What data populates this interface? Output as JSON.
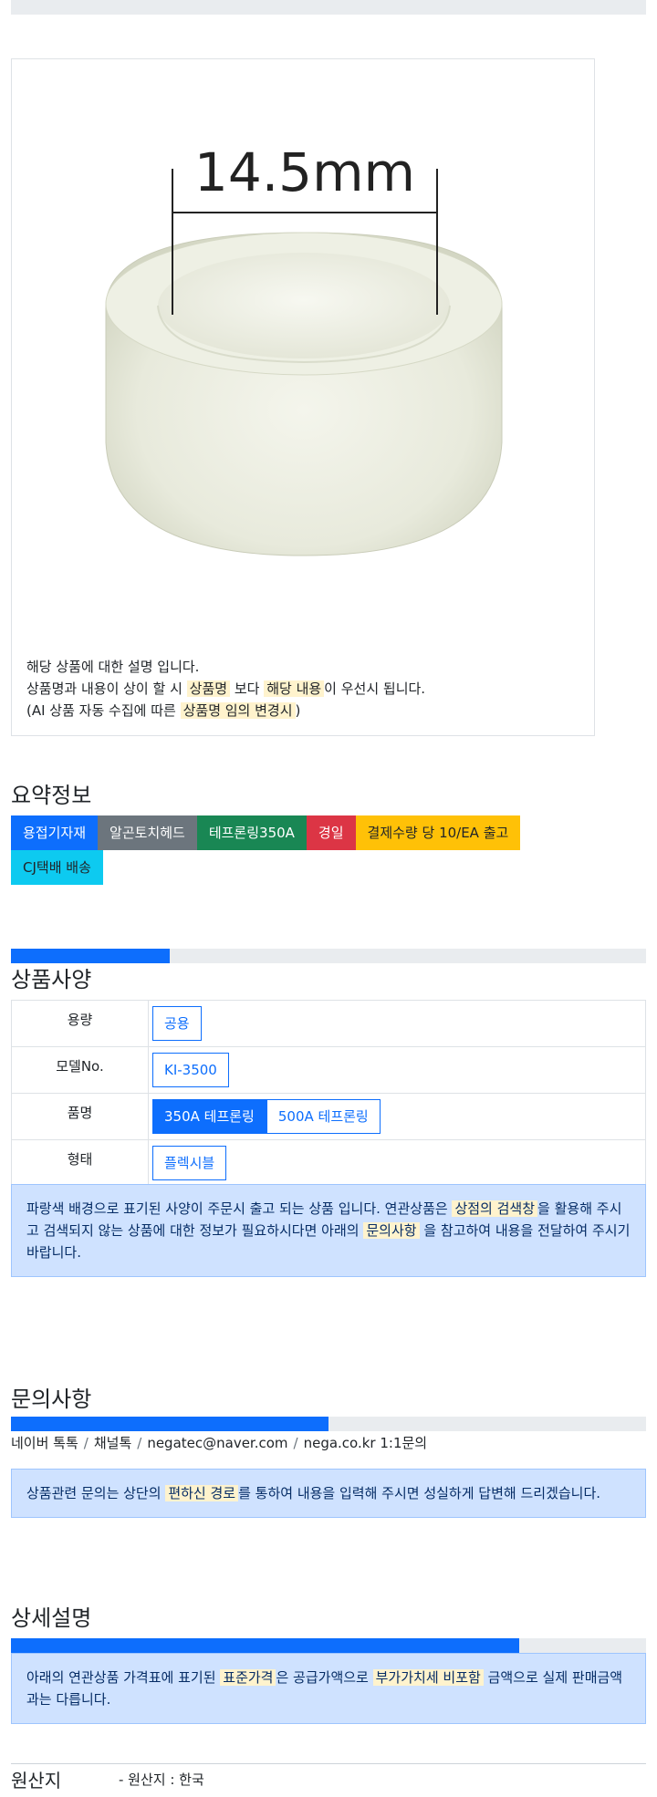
{
  "image": {
    "dimension_label": "14.5mm",
    "alt": "테프론링"
  },
  "description": {
    "line1": "해당 상품에 대한 설명 입니다.",
    "line2_a": "상품명과 내용이 상이 할 시 ",
    "line2_hl1": "상품명",
    "line2_b": " 보다 ",
    "line2_hl2": "해당 내용",
    "line2_c": "이 우선시 됩니다.",
    "line3_a": "(AI 상품 자동 수집에 따른 ",
    "line3_hl": "상품명 임의 변경시",
    "line3_b": ")"
  },
  "summary": {
    "title": "요약정보",
    "badges": [
      {
        "label": "용접기자재",
        "color": "#0d6efd",
        "text_color": "#ffffff"
      },
      {
        "label": "알곤토치헤드",
        "color": "#6c757d",
        "text_color": "#ffffff"
      },
      {
        "label": "테프론링350A",
        "color": "#198754",
        "text_color": "#ffffff"
      },
      {
        "label": "경일",
        "color": "#dc3545",
        "text_color": "#ffffff"
      },
      {
        "label": "결제수량 당 10/EA 출고",
        "color": "#ffc107",
        "text_color": "#212529"
      },
      {
        "label": "CJ택배 배송",
        "color": "#0dcaf0",
        "text_color": "#212529"
      }
    ]
  },
  "spec": {
    "title": "상품사양",
    "progress": 0.25,
    "rows": [
      {
        "key": "용량",
        "options": [
          "공용"
        ],
        "selected": -1
      },
      {
        "key": "모델No.",
        "options": [
          "KI-3500"
        ],
        "selected": -1
      },
      {
        "key": "품명",
        "options": [
          "350A 테프론링",
          "500A 테프론링"
        ],
        "selected": 0
      },
      {
        "key": "형태",
        "options": [
          "플렉시블"
        ],
        "selected": -1
      }
    ],
    "note_a": "파랑색 배경으로 표기된 사양이 주문시 출고 되는 상품 입니다. 연관상품은 ",
    "note_hl1": "상점의 검색창",
    "note_b": "을 활용해 주시고 검색되지 않는 상품에 대한 정보가 필요하시다면 아래의 ",
    "note_hl2": "문의사항",
    "note_c": " 을 참고하여 내용을 전달하여 주시기 바랍니다."
  },
  "inquiry": {
    "title": "문의사항",
    "progress": 0.5,
    "channels": [
      "네이버 톡톡",
      "채널톡",
      "negatec@naver.com",
      "nega.co.kr 1:1문의"
    ],
    "separator": "/",
    "note_a": "상품관련 문의는 상단의 ",
    "note_hl": "편하신 경로",
    "note_b": "를 통하여 내용을 입력해 주시면 성실하게 답변해 드리겠습니다."
  },
  "detail": {
    "title": "상세설명",
    "progress": 0.8,
    "note_a": "아래의 연관상품 가격표에 표기된 ",
    "note_hl1": "표준가격",
    "note_b": "은 공급가액으로 ",
    "note_hl2": "부가가치세 비포함",
    "note_c": " 금액으로 실제 판매금액과는 다릅니다."
  },
  "origin": {
    "title": "원산지",
    "value": "- 원산지 : 한국"
  }
}
